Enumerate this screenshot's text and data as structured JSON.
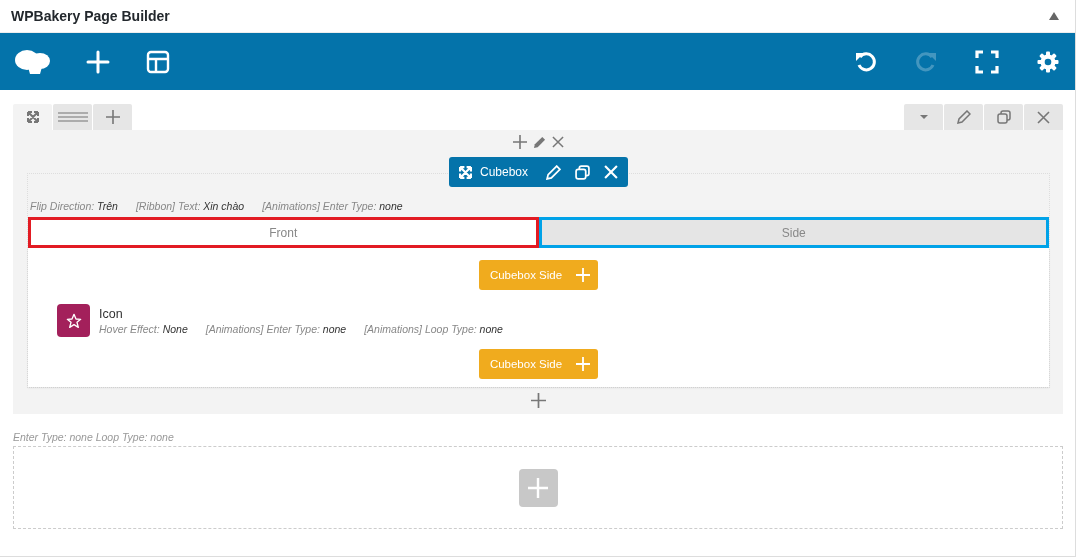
{
  "header": {
    "title": "WPBakery Page Builder",
    "collapsed": false
  },
  "toolbar": {
    "redo_disabled": true
  },
  "element": {
    "title": "Cubebox",
    "params": [
      {
        "label": "Flip Direction:",
        "value": "Trên"
      },
      {
        "label": "[Ribbon] Text:",
        "value": "Xin chào"
      },
      {
        "label": "[Animations] Enter Type:",
        "value": "none"
      }
    ],
    "tabs": [
      {
        "label": "Front",
        "selected": true,
        "color": "#e21b23"
      },
      {
        "label": "Side",
        "selected": false,
        "color": "#00a2e8"
      }
    ],
    "side_buttons": [
      "Cubebox Side",
      "Cubebox Side"
    ],
    "child": {
      "title": "Icon",
      "params": [
        {
          "label": "Hover Effect:",
          "value": "None"
        },
        {
          "label": "[Animations] Enter Type:",
          "value": "none"
        },
        {
          "label": "[Animations] Loop Type:",
          "value": "none"
        }
      ]
    }
  },
  "empty_row": {
    "note": "Enter Type: none  Loop Type: none"
  }
}
